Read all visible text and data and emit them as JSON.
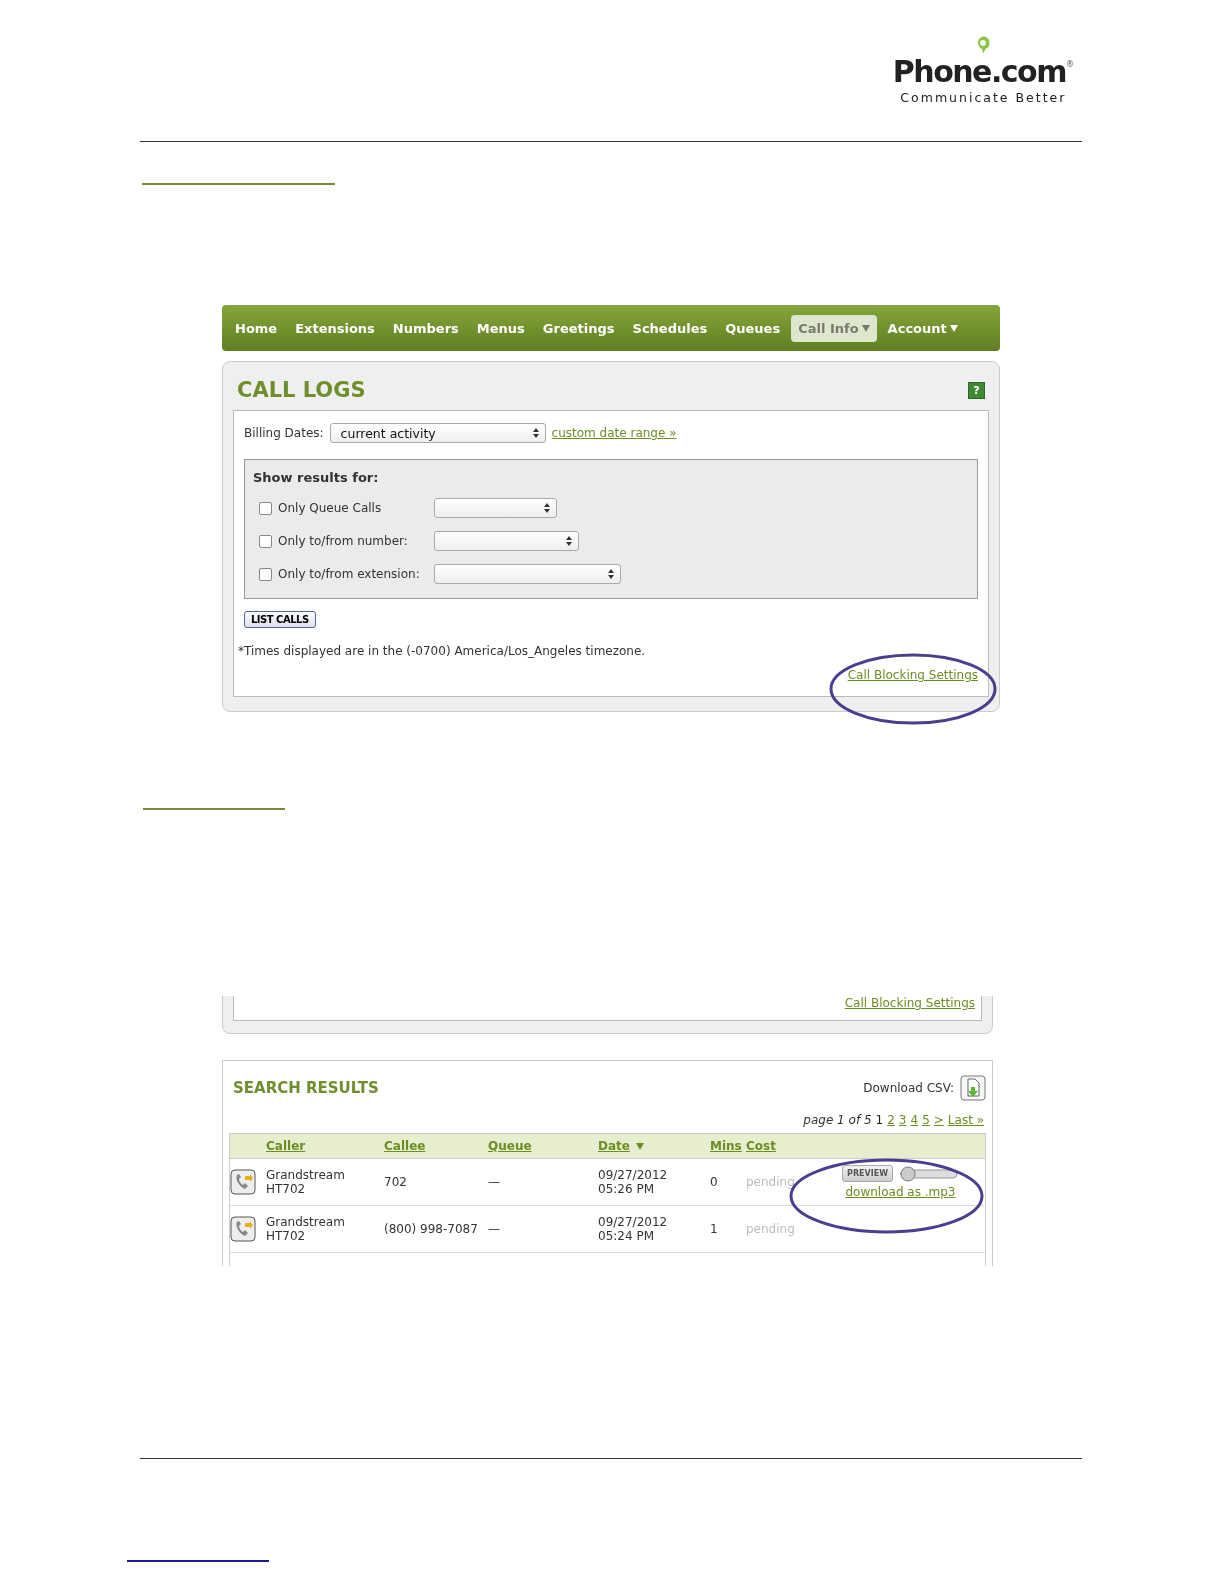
{
  "logo": {
    "name": "Phone.com",
    "mark": "®",
    "tagline": "Communicate Better"
  },
  "call_logs_screenshot": {
    "nav": [
      {
        "label": "Home",
        "selected": false,
        "menu": false
      },
      {
        "label": "Extensions",
        "selected": false,
        "menu": false
      },
      {
        "label": "Numbers",
        "selected": false,
        "menu": false
      },
      {
        "label": "Menus",
        "selected": false,
        "menu": false
      },
      {
        "label": "Greetings",
        "selected": false,
        "menu": false
      },
      {
        "label": "Schedules",
        "selected": false,
        "menu": false
      },
      {
        "label": "Queues",
        "selected": false,
        "menu": false
      },
      {
        "label": "Call Info",
        "selected": true,
        "menu": true
      },
      {
        "label": "Account",
        "selected": false,
        "menu": true
      }
    ],
    "title": "CALL LOGS",
    "help": "?",
    "billing_label": "Billing Dates:",
    "billing_value": "current activity",
    "custom_range_link": "custom date range »",
    "filter_title": "Show results for:",
    "filters": [
      {
        "label": "Only Queue Calls",
        "checked": false
      },
      {
        "label": "Only to/from number:",
        "checked": false
      },
      {
        "label": "Only to/from extension:",
        "checked": false
      }
    ],
    "list_button": "LIST CALLS",
    "timezone_note": "*Times displayed are in the (-0700) America/Los_Angeles timezone.",
    "blocking_link": "Call Blocking Settings"
  },
  "search_results_screenshot": {
    "blocking_link": "Call Blocking Settings",
    "title": "SEARCH RESULTS",
    "download_label": "Download CSV:",
    "page_summary": "page 1 of 5",
    "pages": [
      {
        "label": "1",
        "selected": true
      },
      {
        "label": "2",
        "selected": false
      },
      {
        "label": "3",
        "selected": false
      },
      {
        "label": "4",
        "selected": false
      },
      {
        "label": "5",
        "selected": false
      },
      {
        "label": ">",
        "selected": false
      },
      {
        "label": "Last »",
        "selected": false
      }
    ],
    "columns": [
      {
        "label": "Caller",
        "sorted": false
      },
      {
        "label": "Callee",
        "sorted": false
      },
      {
        "label": "Queue",
        "sorted": false
      },
      {
        "label": "Date",
        "sorted": true
      },
      {
        "label": "Mins",
        "sorted": false
      },
      {
        "label": "Cost",
        "sorted": false
      }
    ],
    "rows": [
      {
        "caller": "Grandstream HT702",
        "callee": "702",
        "queue": "—",
        "date": "09/27/2012 05:26 PM",
        "mins": "0",
        "cost": "pending",
        "preview": "PREVIEW",
        "level": 0,
        "download": "download as .mp3"
      },
      {
        "caller": "Grandstream HT702",
        "callee": "(800) 998-7087",
        "queue": "—",
        "date": "09/27/2012 05:24 PM",
        "mins": "1",
        "cost": "pending"
      }
    ]
  }
}
